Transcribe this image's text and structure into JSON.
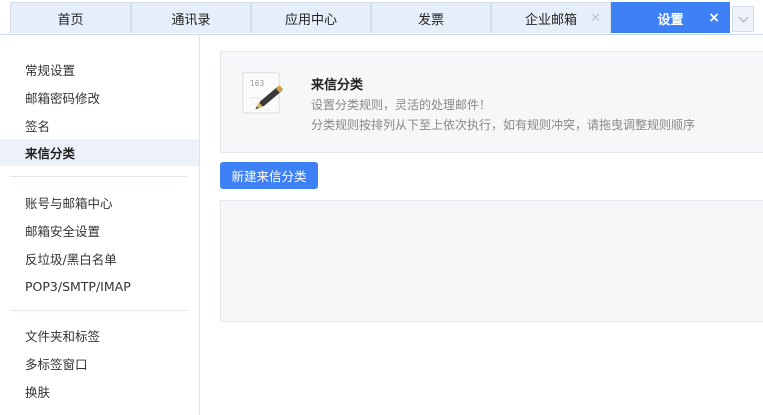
{
  "tabs": [
    {
      "label": "首页",
      "closable": false,
      "active": false
    },
    {
      "label": "通讯录",
      "closable": false,
      "active": false
    },
    {
      "label": "应用中心",
      "closable": false,
      "active": false
    },
    {
      "label": "发票",
      "closable": false,
      "active": false
    },
    {
      "label": "企业邮箱",
      "closable": true,
      "active": false
    },
    {
      "label": "设置",
      "closable": true,
      "active": true
    }
  ],
  "tab_close_glyph": "×",
  "sidebar": {
    "groups": [
      [
        "常规设置",
        "邮箱密码修改",
        "签名",
        "来信分类"
      ],
      [
        "账号与邮箱中心",
        "邮箱安全设置",
        "反垃圾/黑白名单",
        "POP3/SMTP/IMAP"
      ],
      [
        "文件夹和标签",
        "多标签窗口",
        "换肤"
      ]
    ],
    "active_item": "来信分类"
  },
  "info": {
    "title": "来信分类",
    "desc1": "设置分类规则，灵活的处理邮件！",
    "desc2": "分类规则按排列从下至上依次执行，如有规则冲突，请拖曳调整规则顺序",
    "icon": "mail-pen-icon",
    "icon_stamp": "163"
  },
  "new_button_label": "新建来信分类",
  "colors": {
    "accent": "#3e80f6",
    "tab_bg": "#e6eefa",
    "panel_bg": "#f6f7f9"
  }
}
